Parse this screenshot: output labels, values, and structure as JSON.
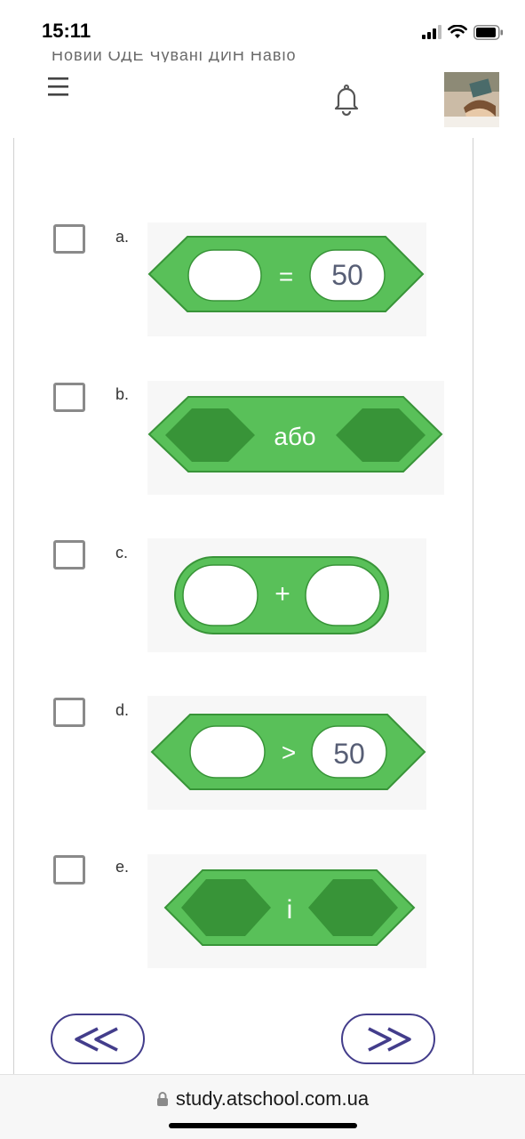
{
  "status_bar": {
    "time": "15:11"
  },
  "header": {
    "cut_text": "Новий ОДЕ Чувані ДИН Навіо"
  },
  "options": [
    {
      "letter": "a.",
      "block": {
        "kind": "comparison",
        "operator": "=",
        "right_value": "50"
      }
    },
    {
      "letter": "b.",
      "block": {
        "kind": "boolean",
        "label": "або"
      }
    },
    {
      "letter": "c.",
      "block": {
        "kind": "reporter",
        "operator": "+"
      }
    },
    {
      "letter": "d.",
      "block": {
        "kind": "comparison",
        "operator": ">",
        "right_value": "50"
      }
    },
    {
      "letter": "e.",
      "block": {
        "kind": "boolean",
        "label": "і"
      }
    }
  ],
  "navigation": {
    "prev_label": "≪",
    "next_label": "≫"
  },
  "url_bar": {
    "url": "study.atschool.com.ua"
  },
  "colors": {
    "block_green": "#59c059",
    "block_border": "#389438",
    "block_dark_slot": "#389438",
    "nav_purple": "#433d8b"
  },
  "icons": [
    "menu-icon",
    "bell-icon",
    "lock-icon",
    "signal-icon",
    "wifi-icon",
    "battery-icon"
  ]
}
